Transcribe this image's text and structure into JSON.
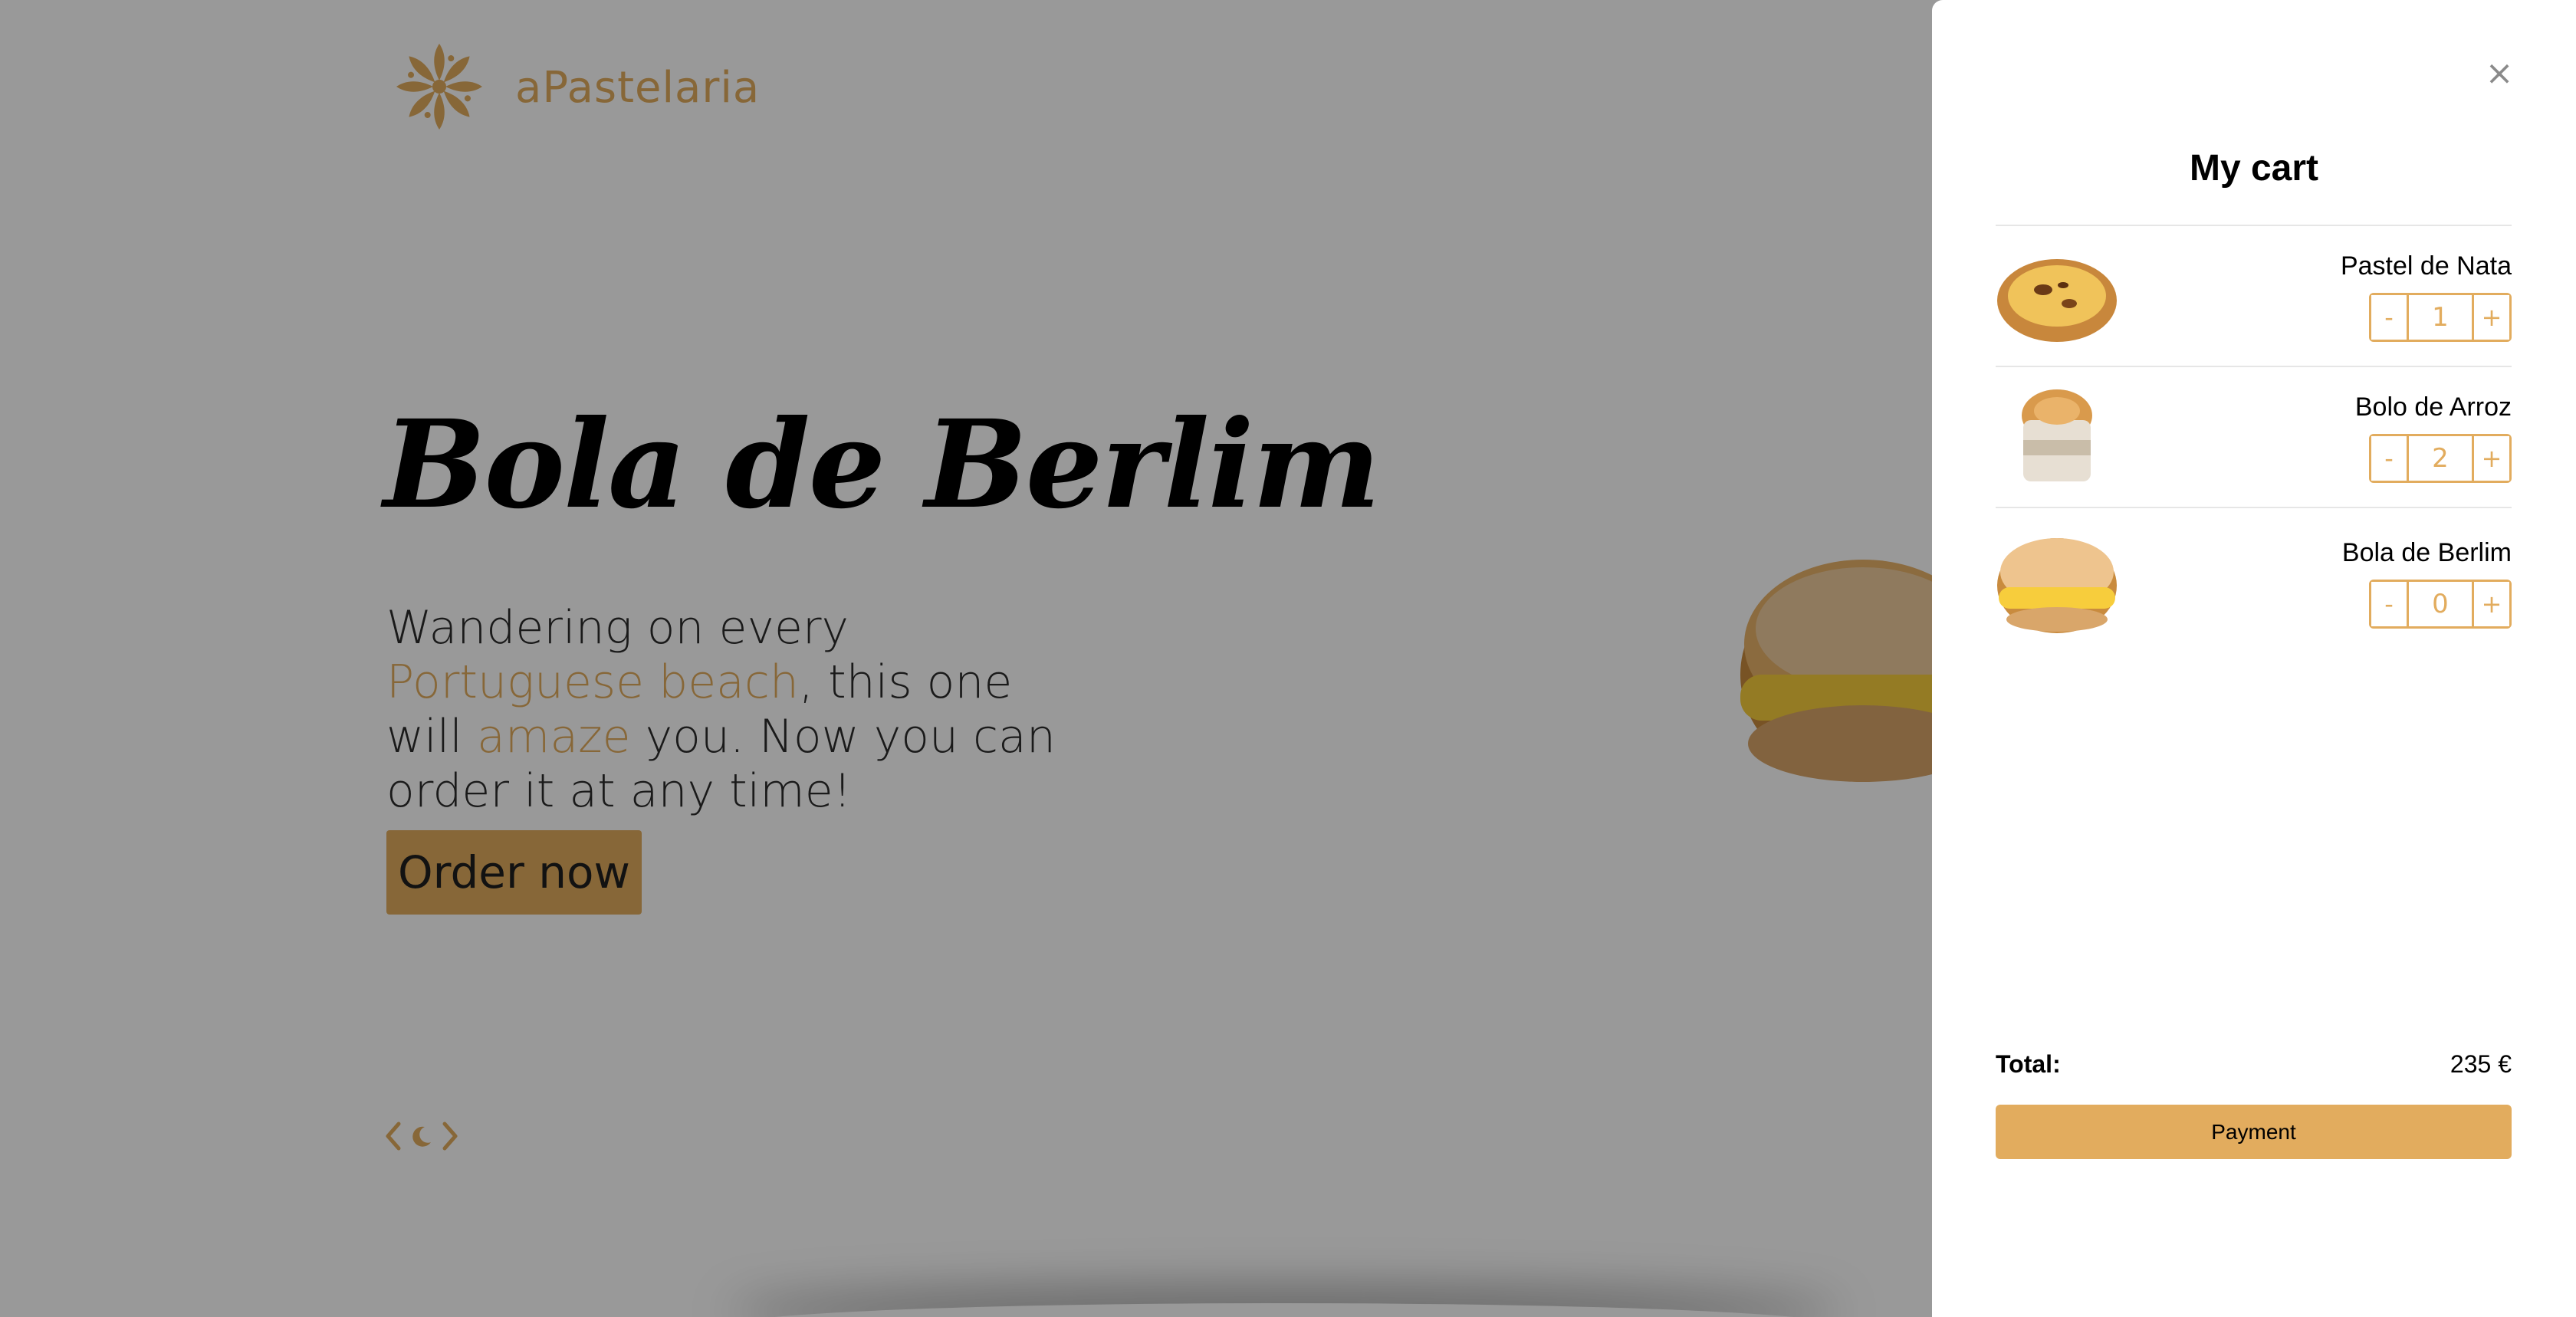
{
  "brand": {
    "name": "aPastelaria",
    "accent_color": "#e2ac5e",
    "logo_icon": "flower-ornament-logo"
  },
  "hero": {
    "title": "Bola de Berlim",
    "text_parts": [
      "Wandering on every ",
      "Portuguese beach",
      ", this one will ",
      "amaze",
      " you. Now you can order it at any time!"
    ],
    "cta_label": "Order now",
    "image": "bola-de-berlim-pastry"
  },
  "slider_nav": {
    "prev_icon": "chevron-left-icon",
    "indicator_icon": "crescent-moon-icon",
    "next_icon": "chevron-right-icon"
  },
  "overlay_color": "rgba(0,0,0,0.4)",
  "cart": {
    "title": "My cart",
    "close_icon": "×",
    "items": [
      {
        "name": "Pastel de Nata",
        "quantity": "1",
        "image": "pastel-de-nata-pastry"
      },
      {
        "name": "Bolo de Arroz",
        "quantity": "2",
        "image": "bolo-de-arroz-pastry"
      },
      {
        "name": "Bola de Berlim",
        "quantity": "0",
        "image": "bola-de-berlim-pastry"
      }
    ],
    "minus_label": "-",
    "plus_label": "+",
    "total_label": "Total:",
    "total_value": "235 €",
    "payment_label": "Payment"
  }
}
